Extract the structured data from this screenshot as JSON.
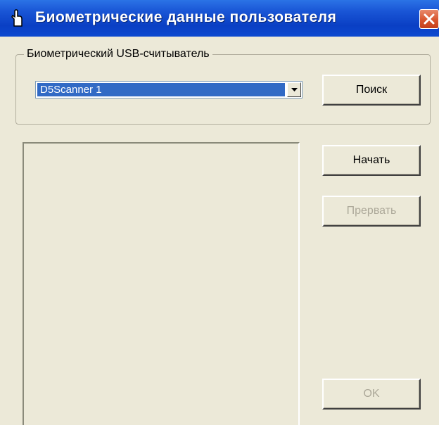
{
  "window": {
    "title": "Биометрические данные пользователя",
    "icons": {
      "app": "hand-pointer-icon",
      "close": "close-icon"
    }
  },
  "reader_group": {
    "label": "Биометрический USB-считыватель",
    "selected_device": "D5Scanner 1",
    "search_label": "Поиск"
  },
  "actions": {
    "start_label": "Начать",
    "abort_label": "Прервать",
    "ok_label": "OK"
  },
  "colors": {
    "title_bar": "#0a3fc4",
    "close_button": "#d8552f",
    "dialog_bg": "#ece9d8",
    "selection": "#316ac5",
    "disabled_text": "#aca899"
  }
}
